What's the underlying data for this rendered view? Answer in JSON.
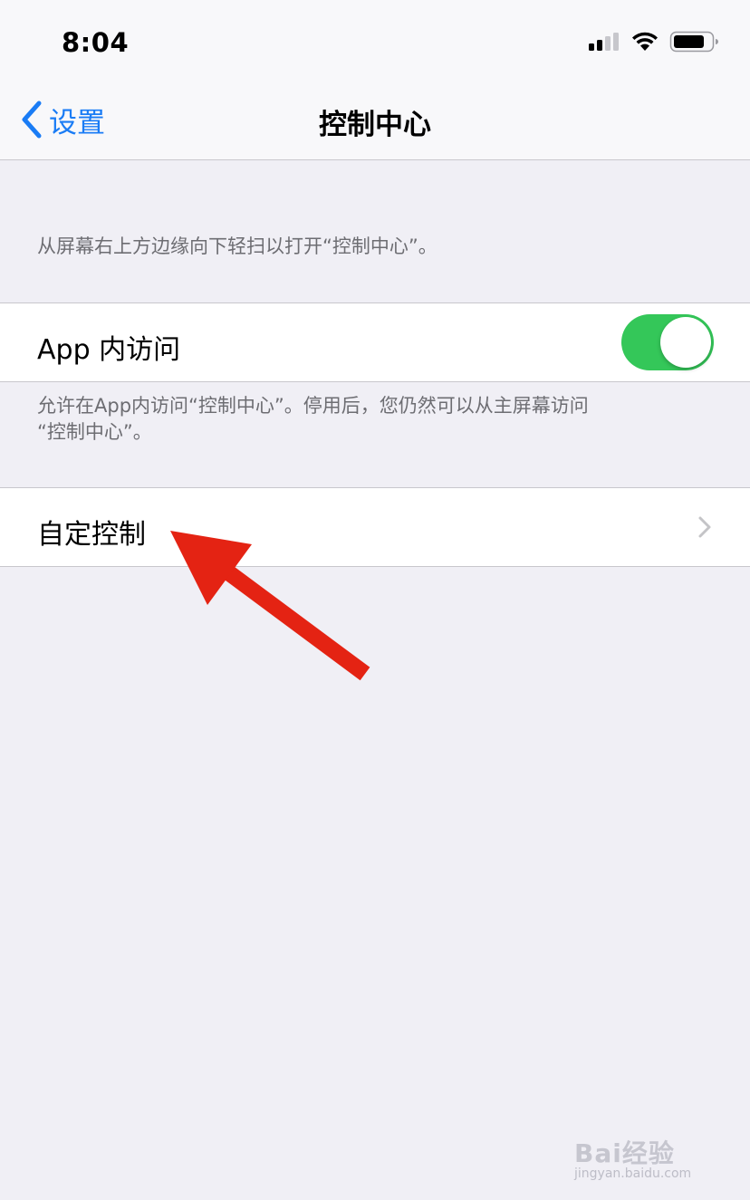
{
  "status_bar": {
    "time": "8:04",
    "icons": [
      "cellular-signal-icon",
      "wifi-icon",
      "battery-icon"
    ]
  },
  "nav": {
    "back_label": "设置",
    "title": "控制中心"
  },
  "intro_hint": "从屏幕右上方边缘向下轻扫以打开“控制中心”。",
  "access_cell": {
    "label": "App 内访问",
    "toggle_on": true
  },
  "access_hint_line1": "允许在App内访问“控制中心”。停用后，您仍然可以从主屏幕访问",
  "access_hint_line2": "“控制中心”。",
  "customize_cell": {
    "label": "自定控制"
  },
  "annotation": {
    "arrow_color": "#e42313"
  },
  "watermark": {
    "main": "Bai经验",
    "sub": "jingyan.baidu.com"
  },
  "colors": {
    "accent": "#1a7cf5",
    "toggle_on": "#34c759",
    "background": "#f0eff5"
  }
}
